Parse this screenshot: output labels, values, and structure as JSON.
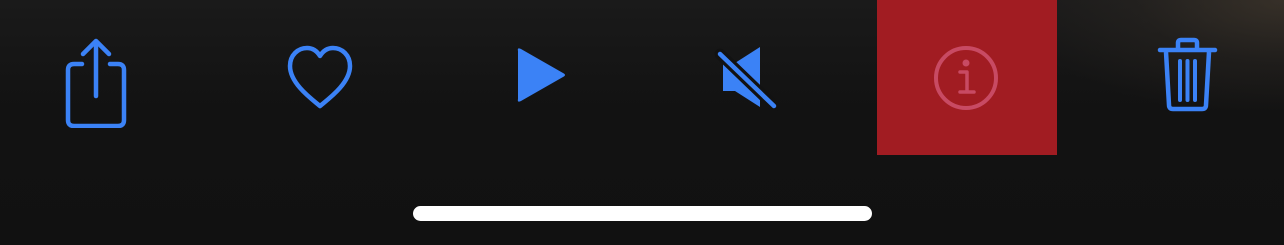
{
  "toolbar": {
    "accent_color": "#3b82f6",
    "highlight_color": "#a11c22",
    "buttons": [
      {
        "name": "share",
        "icon": "share-icon"
      },
      {
        "name": "favorite",
        "icon": "heart-icon"
      },
      {
        "name": "play",
        "icon": "play-icon"
      },
      {
        "name": "mute",
        "icon": "speaker-muted-icon"
      },
      {
        "name": "info",
        "icon": "info-icon",
        "highlighted": true
      },
      {
        "name": "delete",
        "icon": "trash-icon"
      }
    ]
  },
  "home_indicator": {
    "color": "#ffffff"
  }
}
